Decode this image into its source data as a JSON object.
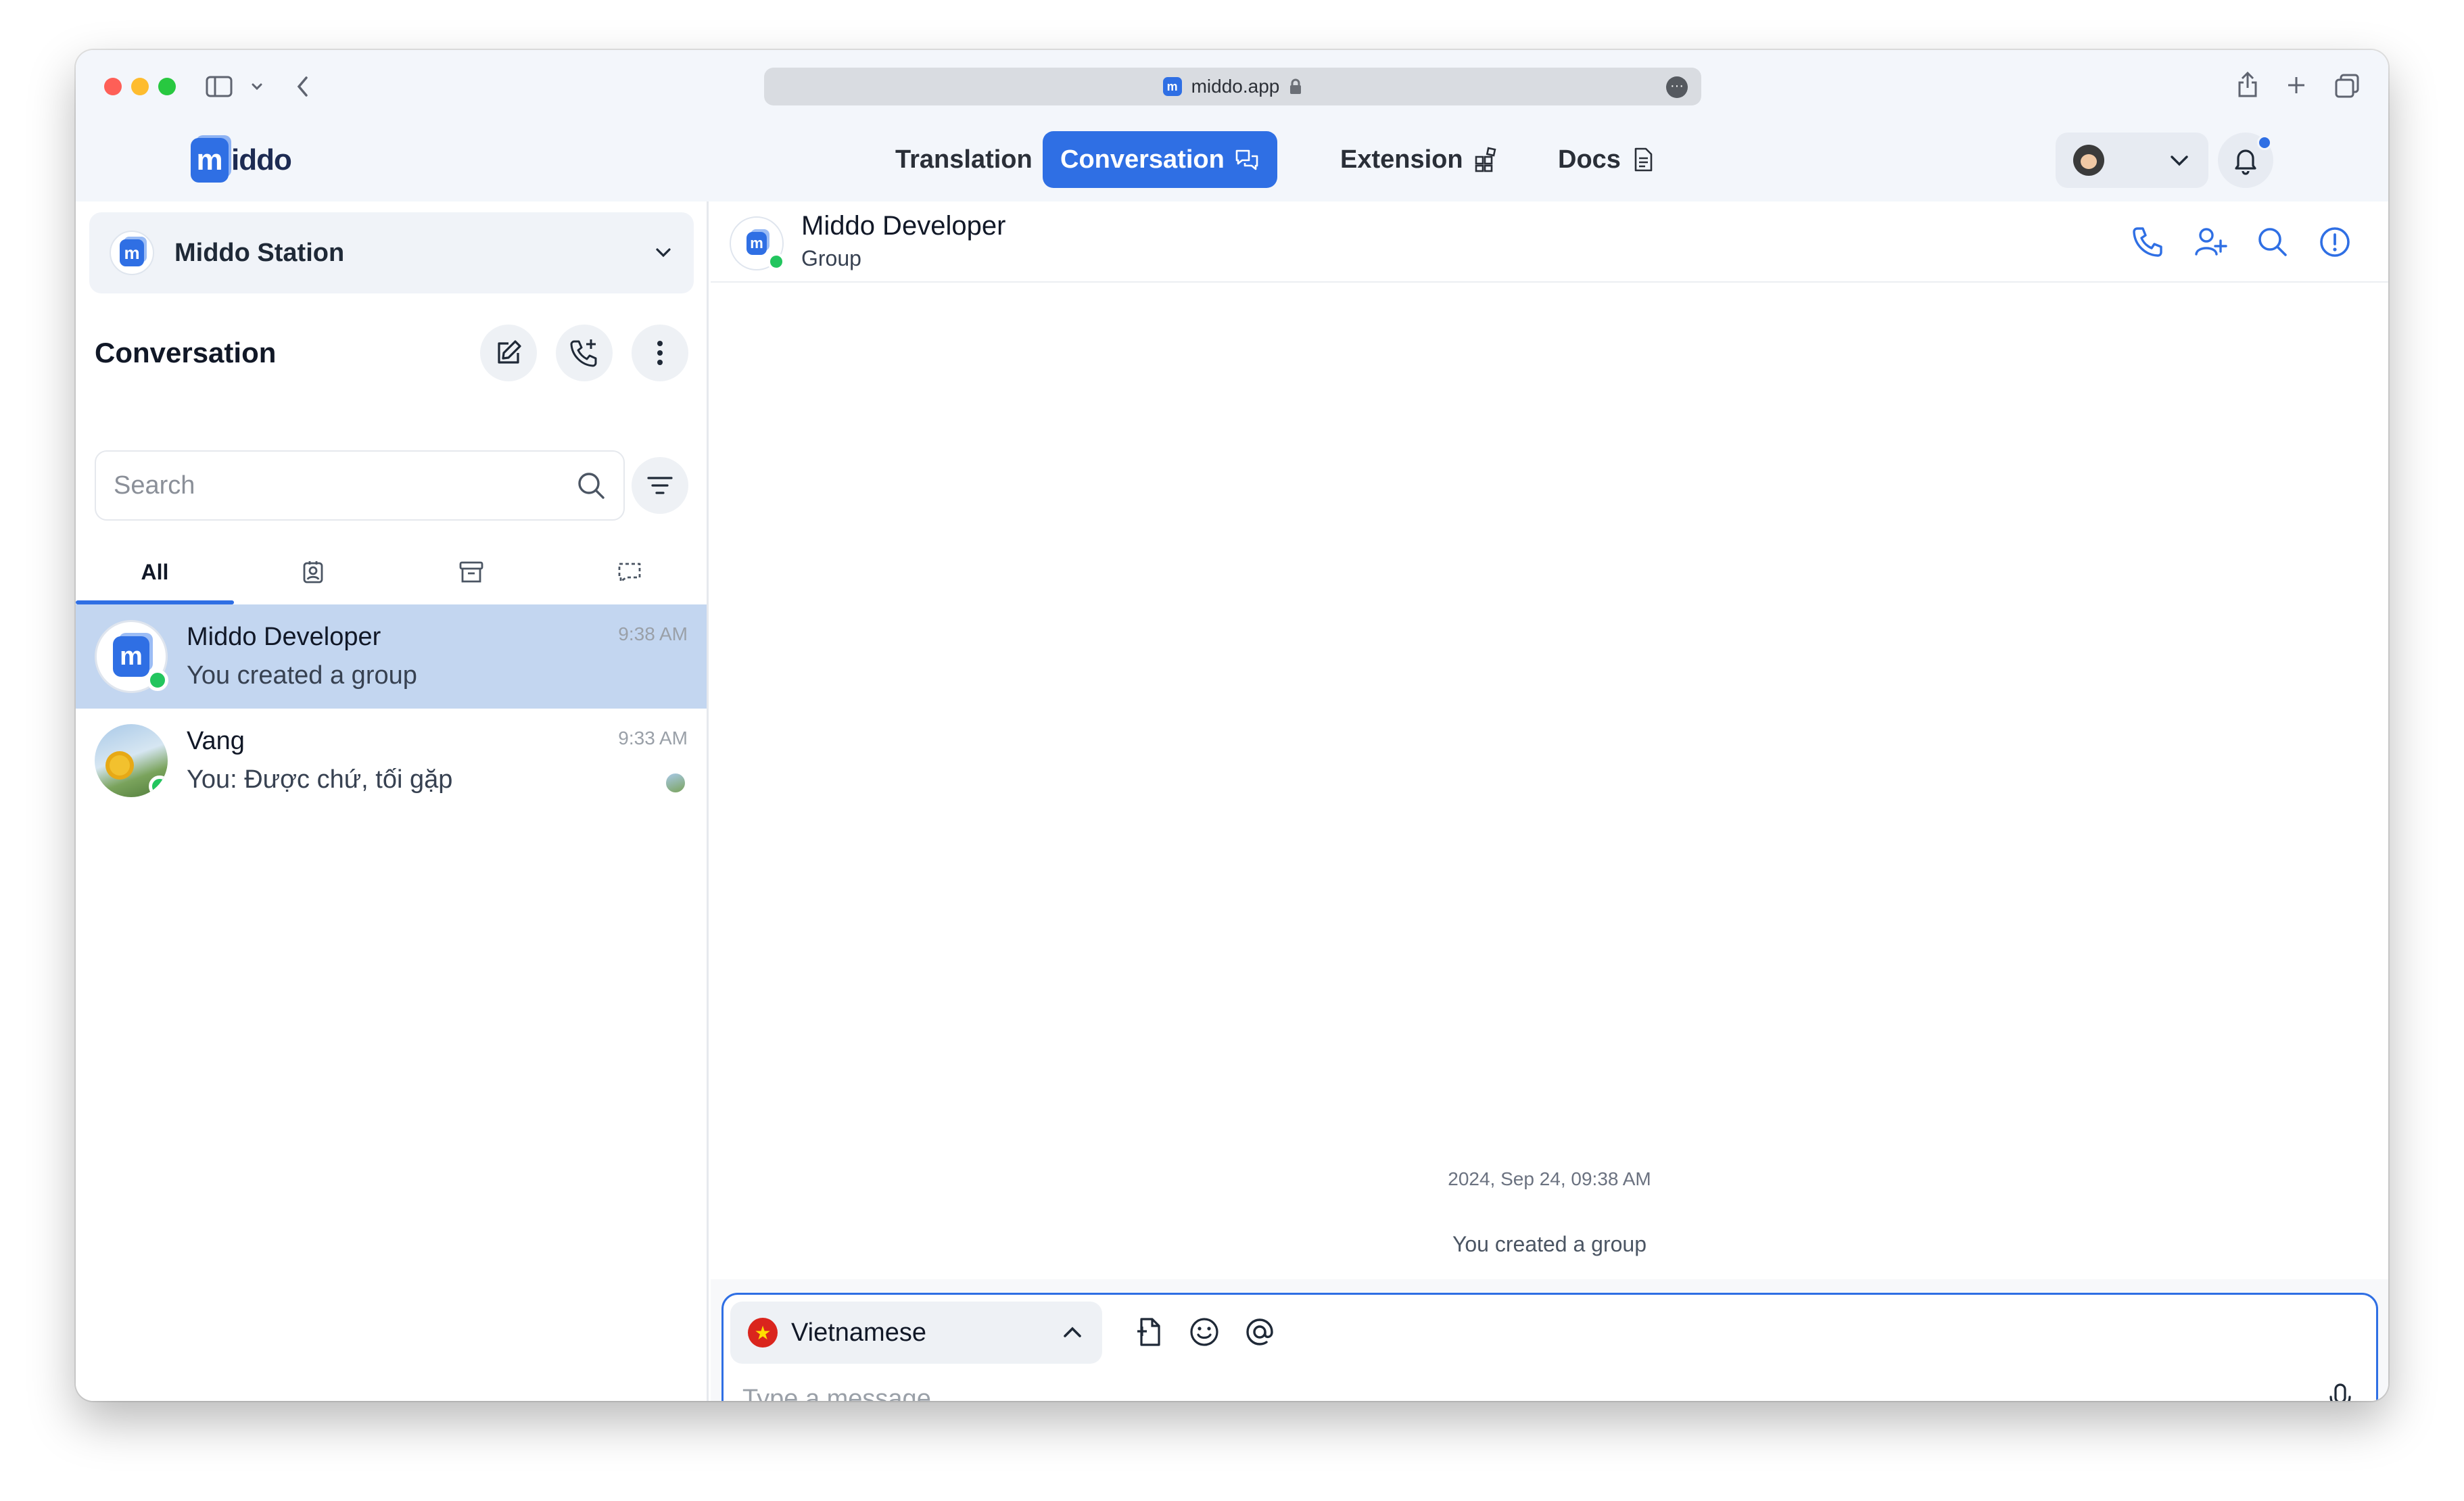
{
  "browser": {
    "url": "middo.app"
  },
  "brand": {
    "logo_text": "iddo",
    "accent_color": "#2f6fe4",
    "online_color": "#22c55e"
  },
  "nav": {
    "items": [
      {
        "label": "Translation",
        "icon": "translate-icon"
      },
      {
        "label": "Conversation",
        "icon": "chat-icon",
        "active": true
      },
      {
        "label": "Extension",
        "icon": "puzzle-icon"
      },
      {
        "label": "Docs",
        "icon": "document-icon"
      }
    ]
  },
  "sidebar": {
    "station_name": "Middo Station",
    "title": "Conversation",
    "search_placeholder": "Search",
    "tabs": [
      {
        "label": "All",
        "active": true
      },
      {
        "icon": "contact-icon"
      },
      {
        "icon": "archive-icon"
      },
      {
        "icon": "dashed-chat-icon"
      }
    ],
    "conversations": [
      {
        "name": "Middo Developer",
        "preview": "You created a group",
        "time": "9:38 AM",
        "selected": true
      },
      {
        "name": "Vang",
        "preview": "You: Được chứ, tối gặp",
        "time": "9:33 AM",
        "selected": false
      }
    ]
  },
  "chat": {
    "title": "Middo Developer",
    "subtitle": "Group",
    "timestamp": "2024, Sep 24, 09:38 AM",
    "system_message": "You created a group",
    "language": "Vietnamese",
    "flag": "★",
    "input_placeholder": "Type a message"
  }
}
